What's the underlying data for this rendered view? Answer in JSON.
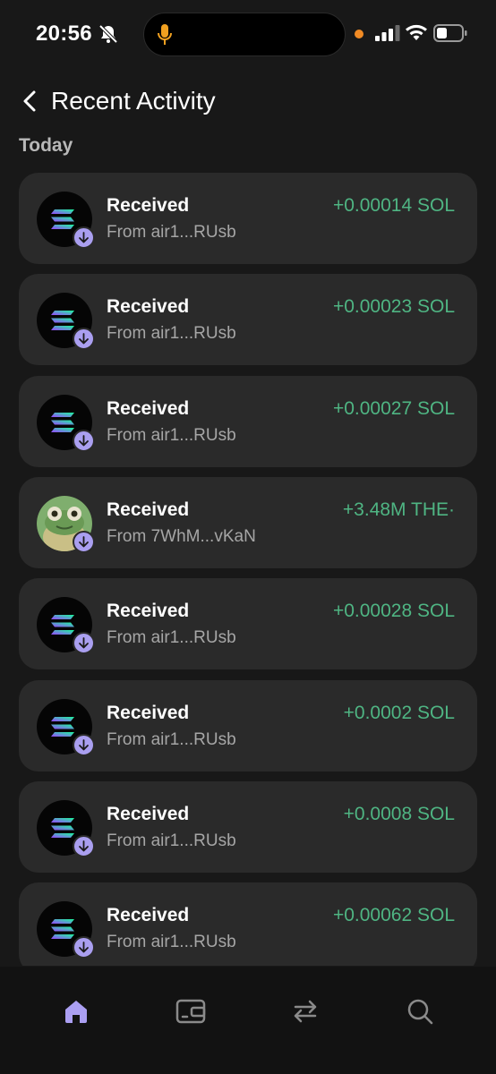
{
  "status_bar": {
    "time": "20:56"
  },
  "header": {
    "title": "Recent Activity",
    "back_icon": "chevron-left-icon"
  },
  "section": {
    "label": "Today"
  },
  "activities": [
    {
      "title": "Received",
      "from": "From air1...RUsb",
      "amount": "+0.00014 SOL",
      "token_icon": "solana-icon"
    },
    {
      "title": "Received",
      "from": "From air1...RUsb",
      "amount": "+0.00023 SOL",
      "token_icon": "solana-icon"
    },
    {
      "title": "Received",
      "from": "From air1...RUsb",
      "amount": "+0.00027 SOL",
      "token_icon": "solana-icon"
    },
    {
      "title": "Received",
      "from": "From 7WhM...vKaN",
      "amount": "+3.48M THE·",
      "token_icon": "frog-token-icon"
    },
    {
      "title": "Received",
      "from": "From air1...RUsb",
      "amount": "+0.00028 SOL",
      "token_icon": "solana-icon"
    },
    {
      "title": "Received",
      "from": "From air1...RUsb",
      "amount": "+0.0002 SOL",
      "token_icon": "solana-icon"
    },
    {
      "title": "Received",
      "from": "From air1...RUsb",
      "amount": "+0.0008 SOL",
      "token_icon": "solana-icon"
    },
    {
      "title": "Received",
      "from": "From air1...RUsb",
      "amount": "+0.00062 SOL",
      "token_icon": "solana-icon"
    }
  ],
  "tab_bar": {
    "tabs": [
      {
        "icon": "home-icon",
        "active": true
      },
      {
        "icon": "wallet-card-icon",
        "active": false
      },
      {
        "icon": "swap-icon",
        "active": false
      },
      {
        "icon": "search-icon",
        "active": false
      }
    ]
  },
  "colors": {
    "background": "#181818",
    "card": "#2a2a2a",
    "amount_positive": "#4fb583",
    "accent_purple": "#aa9ff0",
    "muted_text": "#a6a6a6"
  }
}
